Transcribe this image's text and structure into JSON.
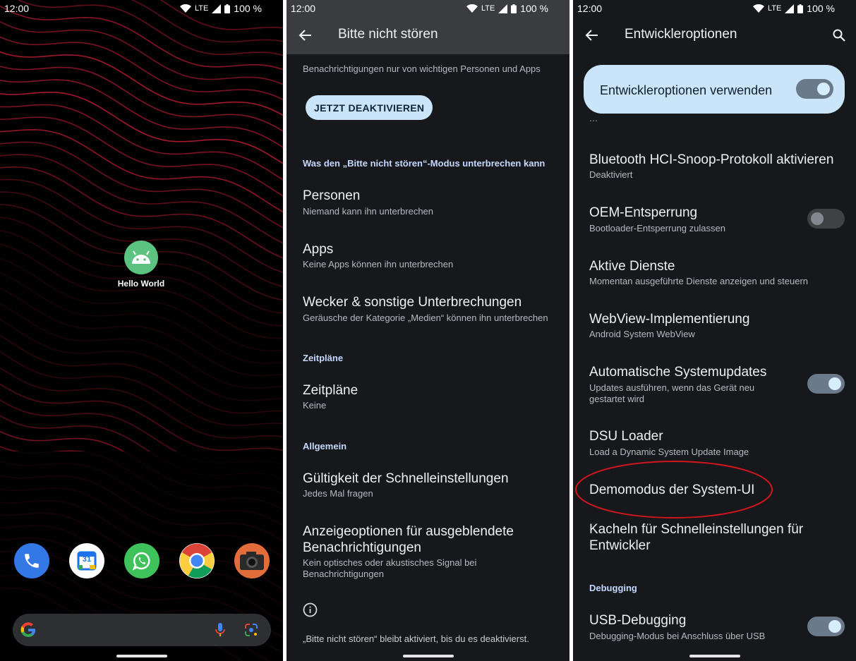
{
  "status": {
    "time": "12:00",
    "network": "LTE",
    "battery": "100 %"
  },
  "home": {
    "app_label": "Hello World",
    "dock": [
      "phone-icon",
      "calendar-icon",
      "whatsapp-icon",
      "chrome-icon",
      "camera-icon"
    ],
    "calendar_day": "31"
  },
  "dnd": {
    "title": "Bitte nicht stören",
    "subtitle": "Benachrichtigungen nur von wichtigen Personen und Apps",
    "button": "JETZT DEAKTIVIEREN",
    "section_interrupt": "Was den „Bitte nicht stören“-Modus unterbrechen kann",
    "items": [
      {
        "title": "Personen",
        "sub": "Niemand kann ihn unterbrechen"
      },
      {
        "title": "Apps",
        "sub": "Keine Apps können ihn unterbrechen"
      },
      {
        "title": "Wecker & sonstige Unterbrechungen",
        "sub": "Geräusche der Kategorie „Medien“ können ihn unterbrechen"
      }
    ],
    "section_schedules": "Zeitpläne",
    "schedules": {
      "title": "Zeitpläne",
      "sub": "Keine"
    },
    "section_general": "Allgemein",
    "general": [
      {
        "title": "Gültigkeit der Schnelleinstellungen",
        "sub": "Jedes Mal fragen"
      },
      {
        "title_1": "Anzeigeoptionen für ausgeblendete",
        "title_2": "Benachrichtigungen",
        "sub_1": "Kein optisches oder akustisches Signal bei",
        "sub_2": "Benachrichtigungen"
      }
    ],
    "footer": "„Bitte nicht stören“ bleibt aktiviert, bis du es deaktivierst."
  },
  "dev": {
    "title": "Entwickleroptionen",
    "master_switch": {
      "label": "Entwickleroptionen verwenden",
      "on": true
    },
    "items": [
      {
        "title": "Bluetooth HCI-Snoop-Protokoll aktivieren",
        "sub": "Deaktiviert"
      },
      {
        "title": "OEM-Entsperrung",
        "sub": "Bootloader-Entsperrung zulassen",
        "toggle": false
      },
      {
        "title": "Aktive Dienste",
        "sub": "Momentan ausgeführte Dienste anzeigen und steuern"
      },
      {
        "title": "WebView-Implementierung",
        "sub": "Android System WebView"
      },
      {
        "title": "Automatische Systemupdates",
        "sub_1": "Updates ausführen, wenn das Gerät neu",
        "sub_2": "gestartet wird",
        "toggle": true
      },
      {
        "title": "DSU Loader",
        "sub": "Load a Dynamic System Update Image"
      },
      {
        "title": "Demomodus der System-UI"
      },
      {
        "title_1": "Kacheln für Schnelleinstellungen für",
        "title_2": "Entwickler"
      }
    ],
    "section_debugging": "Debugging",
    "usb": {
      "title": "USB-Debugging",
      "sub": "Debugging-Modus bei Anschluss über USB",
      "toggle": true
    }
  },
  "colors": {
    "panel_bg": "#17181b",
    "accent": "#cae5fa",
    "highlight_circle": "#d0161c",
    "section": "#c5d8ff"
  }
}
